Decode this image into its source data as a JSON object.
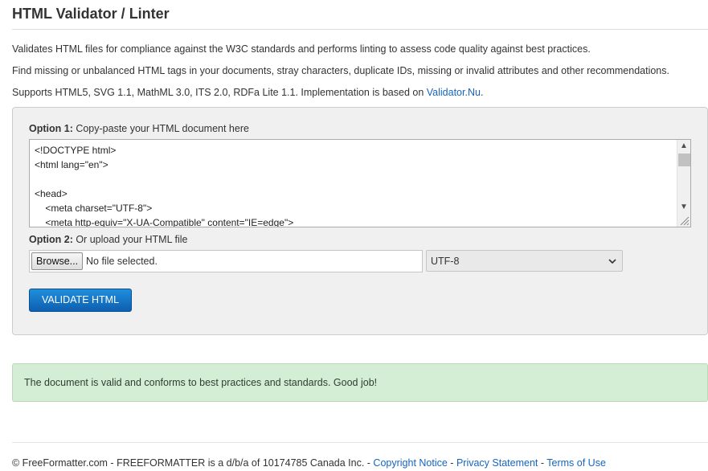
{
  "page": {
    "title": "HTML Validator / Linter"
  },
  "description": {
    "line1": "Validates HTML files for compliance against the W3C standards and performs linting to assess code quality against best practices.",
    "line2": "Find missing or unbalanced HTML tags in your documents, stray characters, duplicate IDs, missing or invalid attributes and other recommendations.",
    "line3_prefix": "Supports HTML5, SVG 1.1, MathML 3.0, ITS 2.0, RDFa Lite 1.1. Implementation is based on ",
    "line3_link": "Validator.Nu",
    "line3_suffix": "."
  },
  "option1": {
    "label_strong": "Option 1:",
    "label_text": " Copy-paste your HTML document here",
    "code": "<!DOCTYPE html>\n<html lang=\"en\">\n\n<head>\n    <meta charset=\"UTF-8\">\n    <meta http-equiv=\"X-UA-Compatible\" content=\"IE=edge\">"
  },
  "option2": {
    "label_strong": "Option 2:",
    "label_text": " Or upload your HTML file",
    "browse_label": "Browse...",
    "file_status": "No file selected.",
    "encoding_selected": "UTF-8"
  },
  "validate_button": "VALIDATE HTML",
  "result_message": "The document is valid and conforms to best practices and standards. Good job!",
  "footer": {
    "text": "© FreeFormatter.com - FREEFORMATTER is a d/b/a of 10174785 Canada Inc. - ",
    "link1": "Copyright Notice",
    "sep1": " - ",
    "link2": "Privacy Statement",
    "sep2": " - ",
    "link3": "Terms of Use"
  },
  "colors": {
    "link": "#1565c0",
    "button": "#1776c8",
    "success_bg": "#d4edd5",
    "panel_bg": "#f0f0f0"
  }
}
